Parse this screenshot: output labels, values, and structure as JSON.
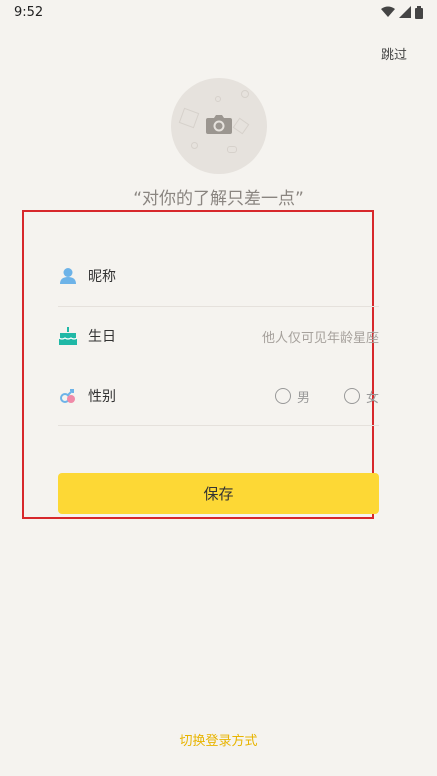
{
  "status_bar": {
    "time": "9:52",
    "icons": [
      "wifi-icon",
      "signal-icon",
      "battery-icon"
    ]
  },
  "header": {
    "skip_label": "跳过"
  },
  "avatar": {
    "icon": "camera-icon"
  },
  "tagline": "“对你的了解只差一点”",
  "form": {
    "nickname": {
      "label": "昵称",
      "value": "",
      "icon": "person-icon"
    },
    "birthday": {
      "label": "生日",
      "hint": "他人仅可见年龄星座",
      "icon": "cake-icon"
    },
    "gender": {
      "label": "性别",
      "icon": "gender-icon",
      "options": [
        "男",
        "女"
      ]
    }
  },
  "save_label": "保存",
  "switch_login_label": "切换登录方式",
  "colors": {
    "accent": "#fdd835",
    "link": "#e8b400",
    "highlight": "#d7282b",
    "background": "#f5f3ef"
  }
}
